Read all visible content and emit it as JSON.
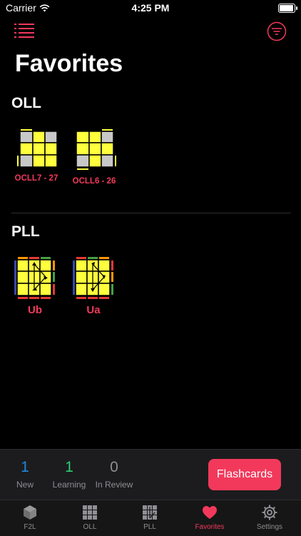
{
  "status_bar": {
    "carrier": "Carrier",
    "time": "4:25 PM"
  },
  "header": {
    "title": "Favorites"
  },
  "sections": {
    "oll": {
      "title": "OLL",
      "cases": [
        {
          "label": "OCLL7 - 27"
        },
        {
          "label": "OCLL6 - 26"
        }
      ]
    },
    "pll": {
      "title": "PLL",
      "cases": [
        {
          "label": "Ub"
        },
        {
          "label": "Ua"
        }
      ]
    }
  },
  "stats": {
    "new": {
      "count": "1",
      "label": "New",
      "color": "#1e88e5"
    },
    "learning": {
      "count": "1",
      "label": "Learning",
      "color": "#2ecc71"
    },
    "review": {
      "count": "0",
      "label": "In Review",
      "color": "#8e8e93"
    }
  },
  "flashcards_button": {
    "label": "Flashcards"
  },
  "tabs": [
    {
      "label": "F2L",
      "icon": "cube-icon"
    },
    {
      "label": "OLL",
      "icon": "grid-icon"
    },
    {
      "label": "PLL",
      "icon": "pll-grid-icon"
    },
    {
      "label": "Favorites",
      "icon": "heart-icon",
      "active": true
    },
    {
      "label": "Settings",
      "icon": "gear-icon"
    }
  ],
  "colors": {
    "accent": "#f2395b",
    "sticker_yellow": "#ffff3d",
    "sticker_gray": "#c8c8c8"
  }
}
